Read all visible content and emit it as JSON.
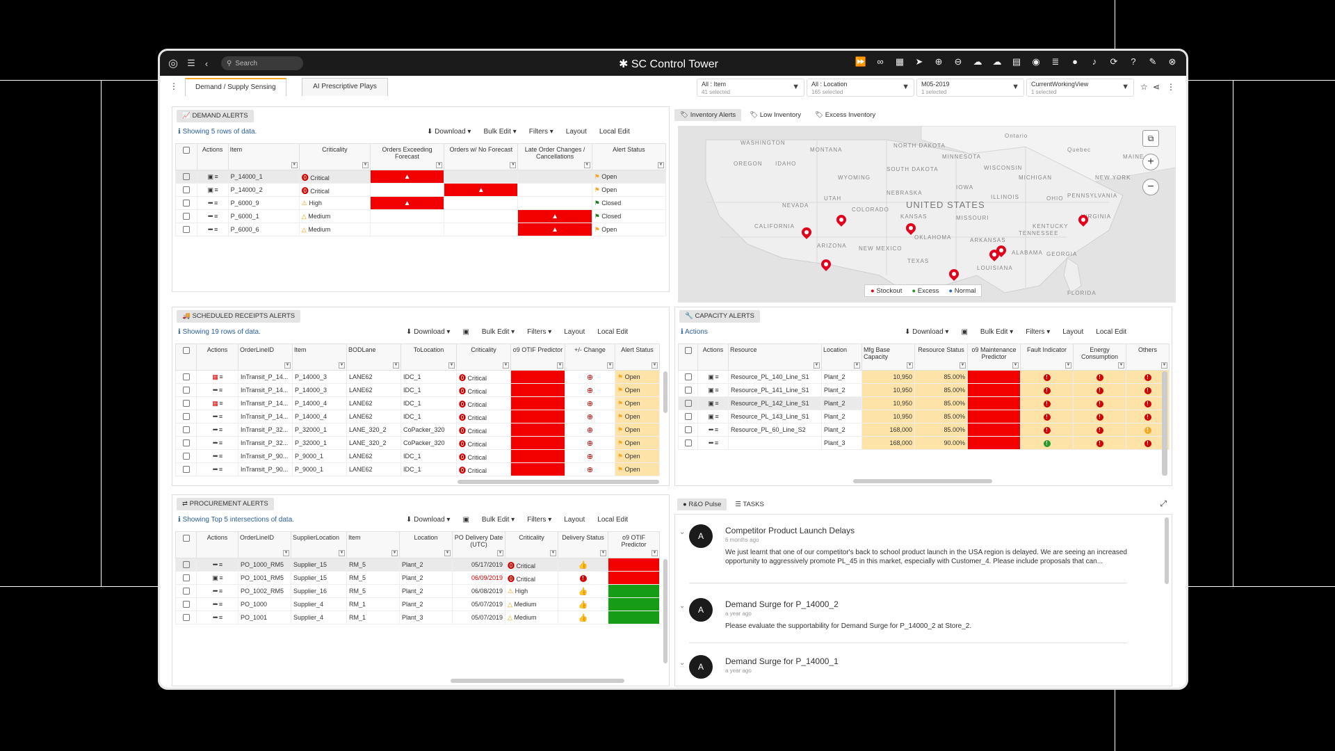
{
  "app": {
    "title": "SC Control Tower",
    "search_placeholder": "Search"
  },
  "tabs": [
    {
      "label": "Demand / Supply Sensing",
      "active": true
    },
    {
      "label": "AI Prescriptive Plays",
      "active": false
    }
  ],
  "page_filters": [
    {
      "label": "All : Item",
      "sub": "41 selected"
    },
    {
      "label": "All : Location",
      "sub": "165 selected"
    },
    {
      "label": "M05-2019",
      "sub": "1 selected"
    },
    {
      "label": "CurrentWorkingView",
      "sub": "1 selected"
    }
  ],
  "toolbar": {
    "download": "Download",
    "bulk_edit": "Bulk Edit",
    "filters": "Filters",
    "layout": "Layout",
    "local_edit": "Local Edit"
  },
  "demand_alerts": {
    "title": "DEMAND ALERTS",
    "info": "Showing 5 rows of data.",
    "columns": [
      "Actions",
      "Item",
      "Criticality",
      "Orders Exceeding Forecast",
      "Orders w/ No Forecast",
      "Late Order Changes / Cancellations",
      "Alert Status"
    ],
    "rows": [
      {
        "item": "P_14000_1",
        "criticality": "Critical",
        "exceed": true,
        "noforecast": false,
        "late": false,
        "status": "Open"
      },
      {
        "item": "P_14000_2",
        "criticality": "Critical",
        "exceed": false,
        "noforecast": true,
        "late": false,
        "status": "Open"
      },
      {
        "item": "P_6000_9",
        "criticality": "High",
        "exceed": true,
        "noforecast": false,
        "late": false,
        "status": "Closed"
      },
      {
        "item": "P_6000_1",
        "criticality": "Medium",
        "exceed": false,
        "noforecast": false,
        "late": true,
        "status": "Closed"
      },
      {
        "item": "P_6000_6",
        "criticality": "Medium",
        "exceed": false,
        "noforecast": false,
        "late": true,
        "status": "Open"
      }
    ]
  },
  "inventory": {
    "tabs": [
      "Inventory Alerts",
      "Low Inventory",
      "Excess Inventory"
    ],
    "map_label": "UNITED STATES",
    "state_labels": [
      "NORTH DAKOTA",
      "MINNESOTA",
      "SOUTH DAKOTA",
      "WISCONSIN",
      "NEBRASKA",
      "IOWA",
      "ILLINOIS",
      "OHIO",
      "NEVADA",
      "UTAH",
      "COLORADO",
      "KANSAS",
      "MISSOURI",
      "OKLAHOMA",
      "ARKANSAS",
      "ALABAMA",
      "TEXAS",
      "LOUISIANA",
      "ARIZONA",
      "NEW MEXICO",
      "MONTANA",
      "IDAHO",
      "WYOMING",
      "OREGON",
      "WASHINGTON",
      "CALIFORNIA",
      "MICHIGAN",
      "KENTUCKY",
      "TENNESSEE",
      "GEORGIA",
      "FLORIDA",
      "VIRGINIA",
      "NEW YORK",
      "PENNSYLVANIA",
      "MAINE",
      "Ontario",
      "Quebec"
    ],
    "legend": [
      "Stockout",
      "Excess",
      "Normal"
    ]
  },
  "receipts": {
    "title": "SCHEDULED RECEIPTS ALERTS",
    "info": "Showing 19 rows of data.",
    "columns": [
      "Actions",
      "OrderLineID",
      "Item",
      "BODLane",
      "ToLocation",
      "Criticality",
      "o9 OTIF Predictor",
      "+/- Change",
      "Alert Status"
    ],
    "rows": [
      {
        "id": "InTransit_P_14...",
        "item": "P_14000_3",
        "lane": "LANE62",
        "to": "IDC_1",
        "crit": "Critical",
        "status": "Open"
      },
      {
        "id": "InTransit_P_14...",
        "item": "P_14000_3",
        "lane": "LANE62",
        "to": "IDC_1",
        "crit": "Critical",
        "status": "Open"
      },
      {
        "id": "InTransit_P_14...",
        "item": "P_14000_4",
        "lane": "LANE62",
        "to": "IDC_1",
        "crit": "Critical",
        "status": "Open"
      },
      {
        "id": "InTransit_P_14...",
        "item": "P_14000_4",
        "lane": "LANE62",
        "to": "IDC_1",
        "crit": "Critical",
        "status": "Open"
      },
      {
        "id": "InTransit_P_32...",
        "item": "P_32000_1",
        "lane": "LANE_320_2",
        "to": "CoPacker_320",
        "crit": "Critical",
        "status": "Open"
      },
      {
        "id": "InTransit_P_32...",
        "item": "P_32000_1",
        "lane": "LANE_320_2",
        "to": "CoPacker_320",
        "crit": "Critical",
        "status": "Open"
      },
      {
        "id": "InTransit_P_90...",
        "item": "P_9000_1",
        "lane": "LANE62",
        "to": "IDC_1",
        "crit": "Critical",
        "status": "Open"
      },
      {
        "id": "InTransit_P_90...",
        "item": "P_9000_1",
        "lane": "LANE62",
        "to": "IDC_1",
        "crit": "Critical",
        "status": "Open"
      }
    ]
  },
  "capacity": {
    "title": "CAPACITY ALERTS",
    "info": "Actions",
    "columns": [
      "Actions",
      "Resource",
      "Location",
      "Mfg Base Capacity",
      "Resource Status",
      "o9 Maintenance Predictor",
      "Fault Indicator",
      "Energy Consumption",
      "Others"
    ],
    "rows": [
      {
        "res": "Resource_PL_140_Line_S1",
        "loc": "Plant_2",
        "cap": "10,950",
        "status": "85.00%",
        "fault": "r",
        "energy": "r",
        "others": "r"
      },
      {
        "res": "Resource_PL_141_Line_S1",
        "loc": "Plant_2",
        "cap": "10,950",
        "status": "85.00%",
        "fault": "r",
        "energy": "r",
        "others": "r"
      },
      {
        "res": "Resource_PL_142_Line_S1",
        "loc": "Plant_2",
        "cap": "10,950",
        "status": "85.00%",
        "fault": "r",
        "energy": "r",
        "others": "r"
      },
      {
        "res": "Resource_PL_143_Line_S1",
        "loc": "Plant_2",
        "cap": "10,950",
        "status": "85.00%",
        "fault": "r",
        "energy": "r",
        "others": "r"
      },
      {
        "res": "Resource_PL_60_Line_S2",
        "loc": "Plant_2",
        "cap": "168,000",
        "status": "85.00%",
        "fault": "r",
        "energy": "r",
        "others": "o"
      },
      {
        "res": "",
        "loc": "Plant_3",
        "cap": "168,000",
        "status": "90.00%",
        "fault": "g",
        "energy": "r",
        "others": "r"
      }
    ]
  },
  "procurement": {
    "title": "PROCUREMENT ALERTS",
    "info": "Showing Top 5 intersections of data.",
    "columns": [
      "Actions",
      "OrderLineID",
      "SupplierLocation",
      "Item",
      "Location",
      "PO Delivery Date (UTC)",
      "Criticality",
      "Delivery Status",
      "o9 OTIF Predictor"
    ],
    "rows": [
      {
        "id": "PO_1000_RM5",
        "sup": "Supplier_15",
        "item": "RM_5",
        "loc": "Plant_2",
        "date": "05/17/2019",
        "late": false,
        "crit": "Critical",
        "ok": true,
        "otif": "red"
      },
      {
        "id": "PO_1001_RM5",
        "sup": "Supplier_15",
        "item": "RM_5",
        "loc": "Plant_2",
        "date": "06/09/2019",
        "late": true,
        "crit": "Critical",
        "ok": false,
        "otif": "red"
      },
      {
        "id": "PO_1002_RM5",
        "sup": "Supplier_16",
        "item": "RM_5",
        "loc": "Plant_2",
        "date": "06/08/2019",
        "late": false,
        "crit": "High",
        "ok": true,
        "otif": "green"
      },
      {
        "id": "PO_1000",
        "sup": "Supplier_4",
        "item": "RM_1",
        "loc": "Plant_2",
        "date": "05/07/2019",
        "late": false,
        "crit": "Medium",
        "ok": true,
        "otif": "green"
      },
      {
        "id": "PO_1001",
        "sup": "Supplier_4",
        "item": "RM_1",
        "loc": "Plant_3",
        "date": "05/07/2019",
        "late": false,
        "crit": "Medium",
        "ok": true,
        "otif": "green"
      }
    ]
  },
  "pulse": {
    "tabs": [
      "R&O Pulse",
      "TASKS"
    ],
    "posts": [
      {
        "avatar": "A",
        "title": "Competitor Product Launch Delays",
        "date": "6 months ago",
        "body": "We just learnt that one of our competitor's back to school product launch in the USA region is delayed. We are seeing an increased opportunity to aggressively promote PL_45 in this market, especially with Customer_4. Please include proposals that can..."
      },
      {
        "avatar": "A",
        "title": "Demand Surge for P_14000_2",
        "date": "a year ago",
        "body": "Please evaluate the supportability for Demand Surge for P_14000_2 at Store_2."
      },
      {
        "avatar": "A",
        "title": "Demand Surge for P_14000_1",
        "date": "a year ago",
        "body": ""
      }
    ]
  }
}
